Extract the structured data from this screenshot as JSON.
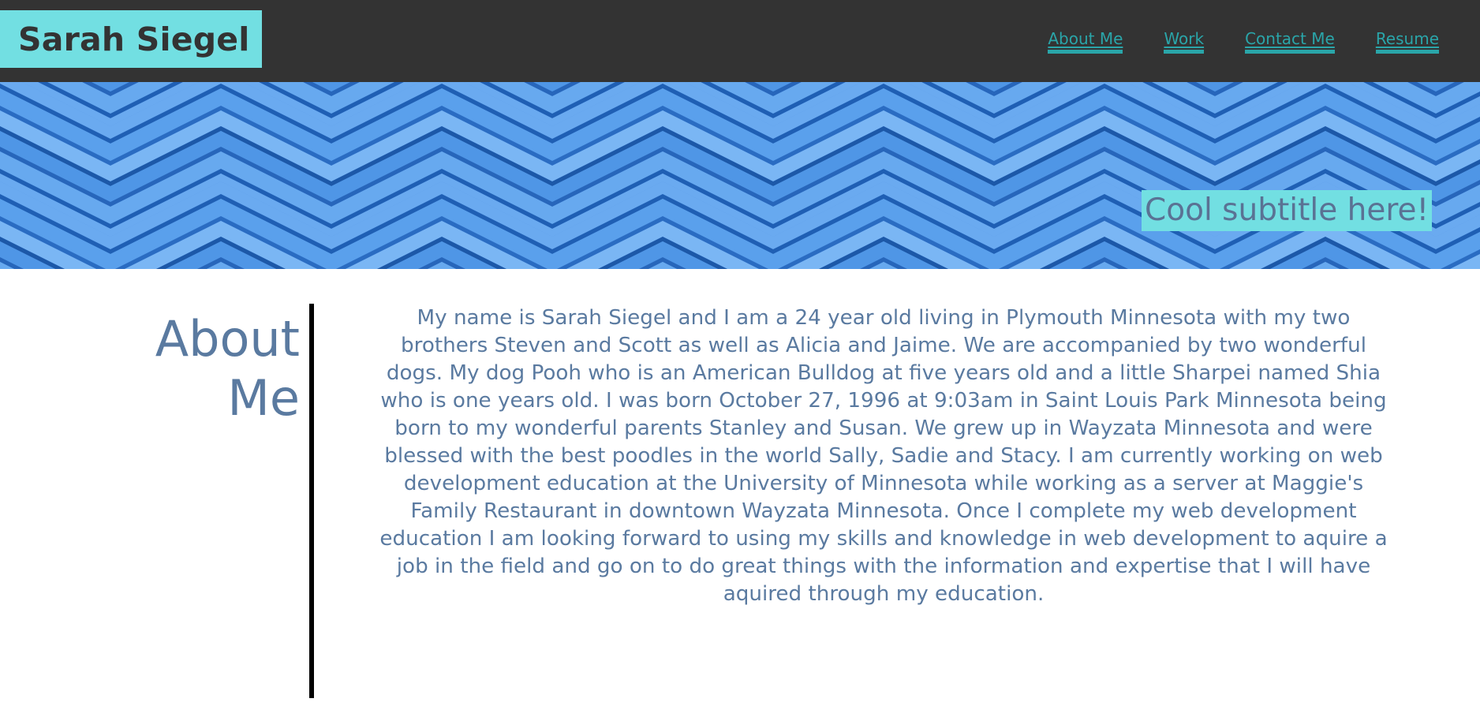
{
  "header": {
    "brand": "Sarah Siegel",
    "nav": [
      {
        "label": "About Me"
      },
      {
        "label": "Work"
      },
      {
        "label": "Contact Me"
      },
      {
        "label": "Resume"
      }
    ]
  },
  "hero": {
    "subtitle": "Cool subtitle here!"
  },
  "about": {
    "heading_line1": "About",
    "heading_line2": "Me",
    "body": "My name is Sarah Siegel and I am a 24 year old living in Plymouth Minnesota with my two brothers Steven and Scott as well as Alicia and Jaime. We are accompanied by two wonderful dogs. My dog Pooh who is an American Bulldog at five years old and a little Sharpei named Shia who is one years old. I was born October 27, 1996 at 9:03am in Saint Louis Park Minnesota being born to my wonderful parents Stanley and Susan. We grew up in Wayzata Minnesota and were blessed with the best poodles in the world Sally, Sadie and Stacy. I am currently working on web development education at the University of Minnesota while working as a server at Maggie's Family Restaurant in downtown Wayzata Minnesota. Once I complete my web development education I am looking forward to using my skills and knowledge in web development to aquire a job in the field and go on to do great things with the information and expertise that I will have aquired through my education."
  },
  "colors": {
    "header_bg": "#333333",
    "brand_bg": "#72dfe2",
    "nav_link": "#2aa5a9",
    "body_text": "#5a7aa0",
    "divider": "#000000",
    "hero_blue": "#4a90e0"
  }
}
